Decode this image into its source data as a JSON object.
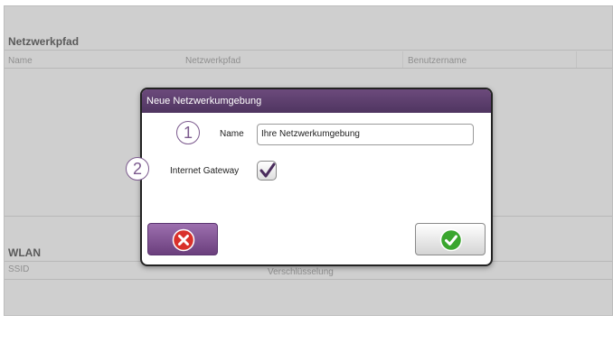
{
  "network_path": {
    "title": "Netzwerkpfad",
    "columns": [
      "Name",
      "Netzwerkpfad",
      "Benutzername"
    ]
  },
  "wlan": {
    "title": "WLAN",
    "columns": [
      "SSID",
      "Verschlüsselung"
    ]
  },
  "dialog": {
    "title": "Neue Netzwerkumgebung",
    "name_label": "Name",
    "name_value": "Ihre Netzwerkumgebung",
    "gateway_label": "Internet Gateway",
    "gateway_checked": true,
    "cancel_icon": "cancel-x-icon",
    "ok_icon": "confirm-check-icon"
  },
  "callouts": [
    "1",
    "2"
  ],
  "colors": {
    "accent": "#5e3f70",
    "cancel_red": "#d9312b",
    "ok_green": "#3aa62e"
  }
}
